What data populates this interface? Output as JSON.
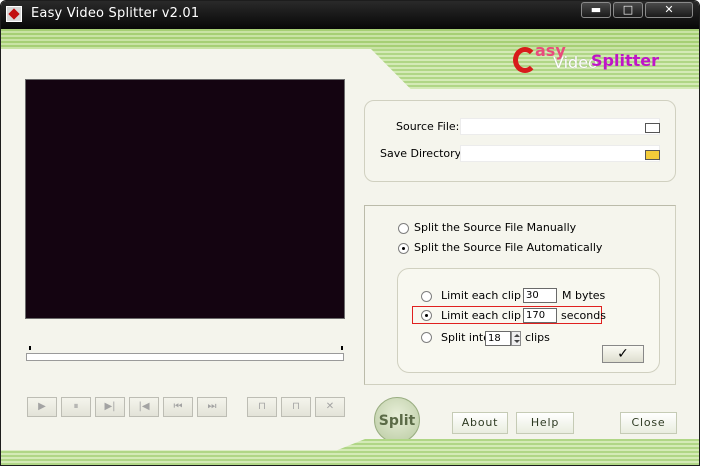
{
  "window": {
    "title": "Easy Video Splitter v2.01",
    "minimize_label": "▬",
    "maximize_label": "□",
    "close_label": "✕"
  },
  "logo": {
    "easy": "asy",
    "video": "Video",
    "splitter": "Splitter"
  },
  "files": {
    "source_label": "Source File:",
    "source_value": "",
    "save_label": "Save Directory:",
    "save_value": ""
  },
  "mode": {
    "manual_label": "Split the Source File Manually",
    "auto_label": "Split the Source File Automatically",
    "selected": "auto"
  },
  "auto_options": {
    "mb_prefix": "Limit each clip to",
    "mb_value": "30",
    "mb_unit": "M bytes",
    "sec_prefix": "Limit each clip to",
    "sec_value": "170",
    "sec_unit": "seconds",
    "clips_prefix": "Split into",
    "clips_value": "18",
    "clips_unit": "clips",
    "selected": "seconds",
    "confirm_label": "✓"
  },
  "playback": {
    "play": "▶",
    "pause": "⏸",
    "step_forward": "▶|",
    "step_back": "|◀",
    "go_start": "⏮",
    "go_end": "⏭",
    "set_start": "⊓",
    "set_end": "⊓",
    "clear": "✕"
  },
  "actions": {
    "split_label": "Split",
    "about_label": "About",
    "help_label": "Help",
    "close_label": "Close"
  }
}
